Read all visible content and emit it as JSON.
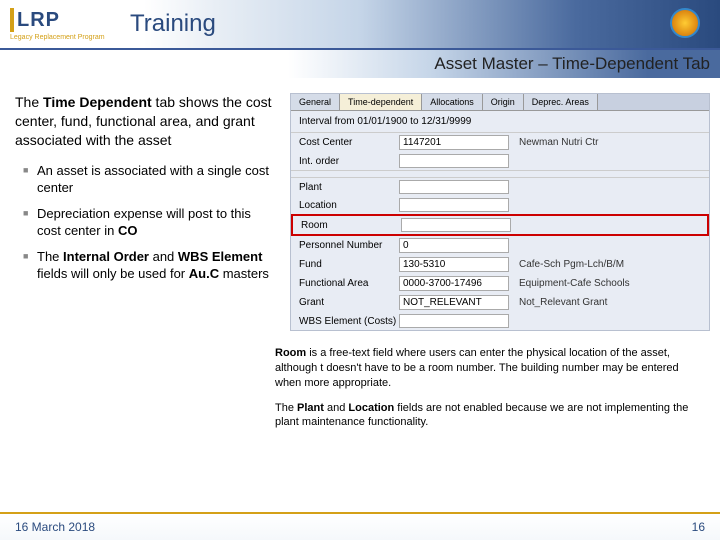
{
  "header": {
    "logo_text": "LRP",
    "logo_subtitle": "Legacy Replacement Program",
    "title": "Training"
  },
  "subtitle": "Asset Master – Time-Dependent Tab",
  "intro": {
    "pre": "The ",
    "bold": "Time Dependent",
    "post": " tab shows the cost center, fund, functional area, and grant associated with the asset"
  },
  "bullets": [
    {
      "text": "An asset is associated with a single cost center"
    },
    {
      "text_pre": "Depreciation expense will post to this cost center in ",
      "bold_a": "CO"
    },
    {
      "text_pre": "The ",
      "bold_a": "Internal Order",
      "mid": " and ",
      "bold_b": "WBS Element",
      "text_post": " fields will only be used for ",
      "bold_c": "Au.C",
      "tail": " masters"
    }
  ],
  "sap": {
    "tabs": [
      "General",
      "Time-dependent",
      "Allocations",
      "Origin",
      "Deprec. Areas"
    ],
    "active_tab_index": 1,
    "interval": "Interval from 01/01/1900 to 12/31/9999",
    "fields_top": [
      {
        "label": "Cost Center",
        "value": "1147201",
        "desc": "Newman Nutri Ctr"
      },
      {
        "label": "Int. order",
        "value": "",
        "desc": ""
      }
    ],
    "fields_bottom": [
      {
        "label": "Plant",
        "value": "",
        "desc": ""
      },
      {
        "label": "Location",
        "value": "",
        "desc": ""
      },
      {
        "label": "Room",
        "value": "",
        "desc": "",
        "highlight": true
      },
      {
        "label": "Personnel Number",
        "value": "0",
        "desc": ""
      },
      {
        "label": "Fund",
        "value": "130-5310",
        "desc": "Cafe-Sch Pgm-Lch/B/M"
      },
      {
        "label": "Functional Area",
        "value": "0000-3700-17496",
        "desc": "Equipment-Cafe Schools"
      },
      {
        "label": "Grant",
        "value": "NOT_RELEVANT",
        "desc": "Not_Relevant Grant"
      },
      {
        "label": "WBS Element (Costs)",
        "value": "",
        "desc": ""
      }
    ]
  },
  "notes": {
    "n1_bold": "Room",
    "n1_rest": " is a free-text field where users can enter the physical location of the asset, although t doesn't have to be a room number.  The building number may be entered when more appropriate.",
    "n2_pre": "The ",
    "n2_b1": "Plant",
    "n2_mid": " and ",
    "n2_b2": "Location",
    "n2_rest": " fields are not enabled because we are not implementing the plant maintenance functionality."
  },
  "footer": {
    "date": "16 March 2018",
    "page": "16"
  }
}
